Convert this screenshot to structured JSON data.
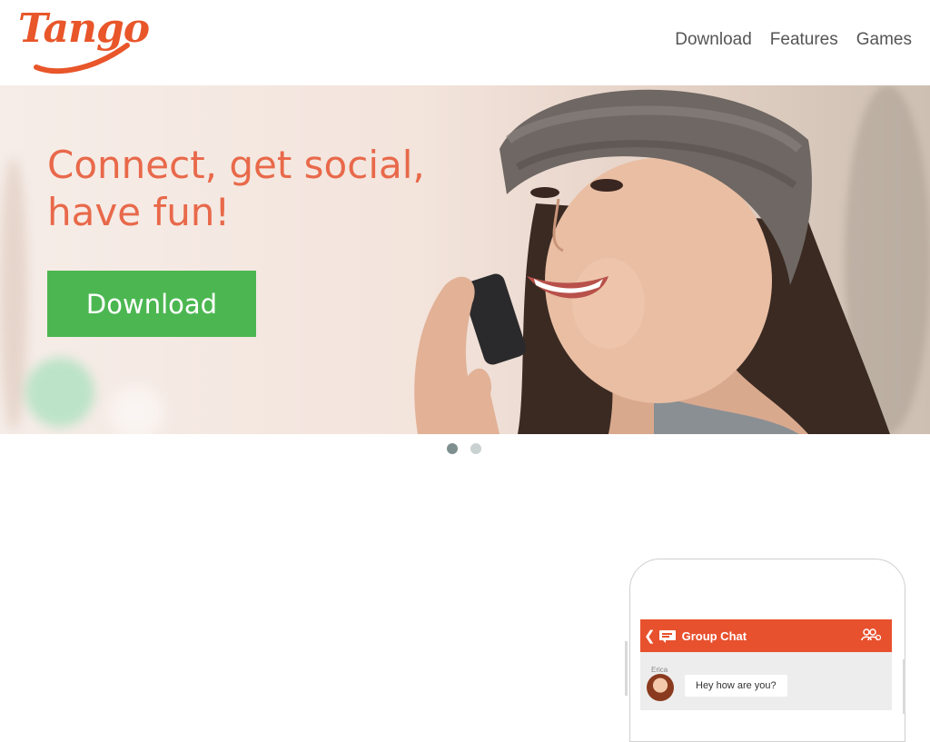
{
  "brand": {
    "logo_text": "Tango",
    "accent_color": "#e8562a"
  },
  "nav": {
    "items": [
      "Download",
      "Features",
      "Games"
    ]
  },
  "hero": {
    "title_line1": "Connect, get social,",
    "title_line2": "have fun!",
    "button_label": "Download",
    "button_color": "#4cb751",
    "image": "woman-on-phone-photo"
  },
  "carousel": {
    "slide_count": 2,
    "active_index": 0,
    "active_color": "#7f8f8f",
    "inactive_color": "#c9d1d1"
  },
  "phone_preview": {
    "header_title": "Group Chat",
    "header_color": "#e8512e",
    "back_icon": "chevron-left-icon",
    "group_icon": "group-people-icon",
    "message_sender": "Erica",
    "message_text": "Hey how are you?"
  }
}
